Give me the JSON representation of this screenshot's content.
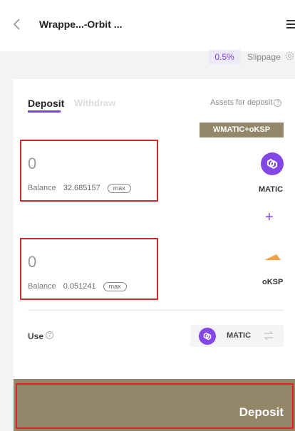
{
  "header": {
    "title": "Wrappe...-Orbit ...",
    "back_icon": "chevron-left-icon",
    "menu_icon": "hamburger-menu-icon"
  },
  "slippage": {
    "value": "0.5%",
    "label": "Slippage",
    "icon": "gear-icon"
  },
  "tabs": {
    "deposit": "Deposit",
    "withdraw": "Withdraw"
  },
  "assets": {
    "label": "Assets for deposit",
    "help": "?",
    "pair": "WMATIC+oKSP"
  },
  "inputs": [
    {
      "amount": "0",
      "balance_label": "Balance",
      "balance": "32.685157",
      "max_label": "max",
      "token": "MATIC"
    },
    {
      "amount": "0",
      "balance_label": "Balance",
      "balance": "0.051241",
      "max_label": "max",
      "token": "oKSP"
    }
  ],
  "plus": "+",
  "use": {
    "label": "Use",
    "help": "?",
    "token": "MATIC"
  },
  "deposit_button": {
    "label": "Deposit"
  },
  "colors": {
    "accent": "#7b3fe4",
    "matic": "#8247e5",
    "oksp": "#f5a142",
    "button": "#948769",
    "highlight": "#d9262b"
  }
}
